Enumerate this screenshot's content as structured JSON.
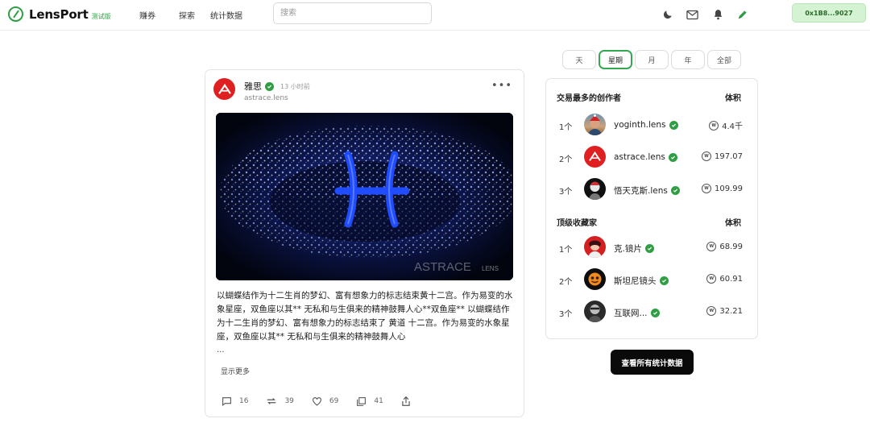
{
  "app": {
    "name": "LensPort",
    "badge": "测试版"
  },
  "nav": [
    {
      "label": "赚券"
    },
    {
      "label": "探索"
    },
    {
      "label": "统计数据"
    }
  ],
  "search": {
    "placeholder": "搜索"
  },
  "wallet": {
    "address": "0x1B8...9027"
  },
  "periods": [
    {
      "label": "天",
      "active": false
    },
    {
      "label": "星期",
      "active": true
    },
    {
      "label": "月",
      "active": false
    },
    {
      "label": "年",
      "active": false
    },
    {
      "label": "全部",
      "active": false
    }
  ],
  "post": {
    "author": "雅思",
    "time": "13 小时前",
    "handle": "astrace.lens",
    "image_watermark": "ASTRACE",
    "image_watermark_small": "LENS",
    "text": "以蝴蝶结作为十二生肖的梦幻、富有想象力的标志结束黄十二宫。作为易变的水象星座，双鱼座以其** 无私和与生俱来的精神鼓舞人心**双鱼座** 以蝴蝶结作为十二生肖的梦幻、富有想象力的标志结束了 黄道 十二宫。作为易变的水象星座，双鱼座以其** 无私和与生俱来的精神鼓舞人心",
    "ellipsis": "...",
    "show_more": "显示更多",
    "stats": {
      "comments": "16",
      "mirrors": "39",
      "likes": "69",
      "collects": "41"
    }
  },
  "top_creators": {
    "title": "交易最多的创作者",
    "volume_label": "体积",
    "rows": [
      {
        "rank": "1个",
        "name": "yoginth.lens",
        "volume": "4.4千"
      },
      {
        "rank": "2个",
        "name": "astrace.lens",
        "volume": "197.07"
      },
      {
        "rank": "3个",
        "name": "悟天克斯.lens",
        "volume": "109.99"
      }
    ]
  },
  "top_collectors": {
    "title": "顶级收藏家",
    "volume_label": "体积",
    "rows": [
      {
        "rank": "1个",
        "name": "克.镜片",
        "volume": "68.99"
      },
      {
        "rank": "2个",
        "name": "斯坦尼镜头",
        "volume": "60.91"
      },
      {
        "rank": "3个",
        "name": "互联网...",
        "volume": "32.21"
      }
    ]
  },
  "all_stats_button": "查看所有统计数据",
  "colors": {
    "accent": "#2f9e44",
    "wallet_bg": "#d3f3d3",
    "astrace_red": "#e02020"
  }
}
